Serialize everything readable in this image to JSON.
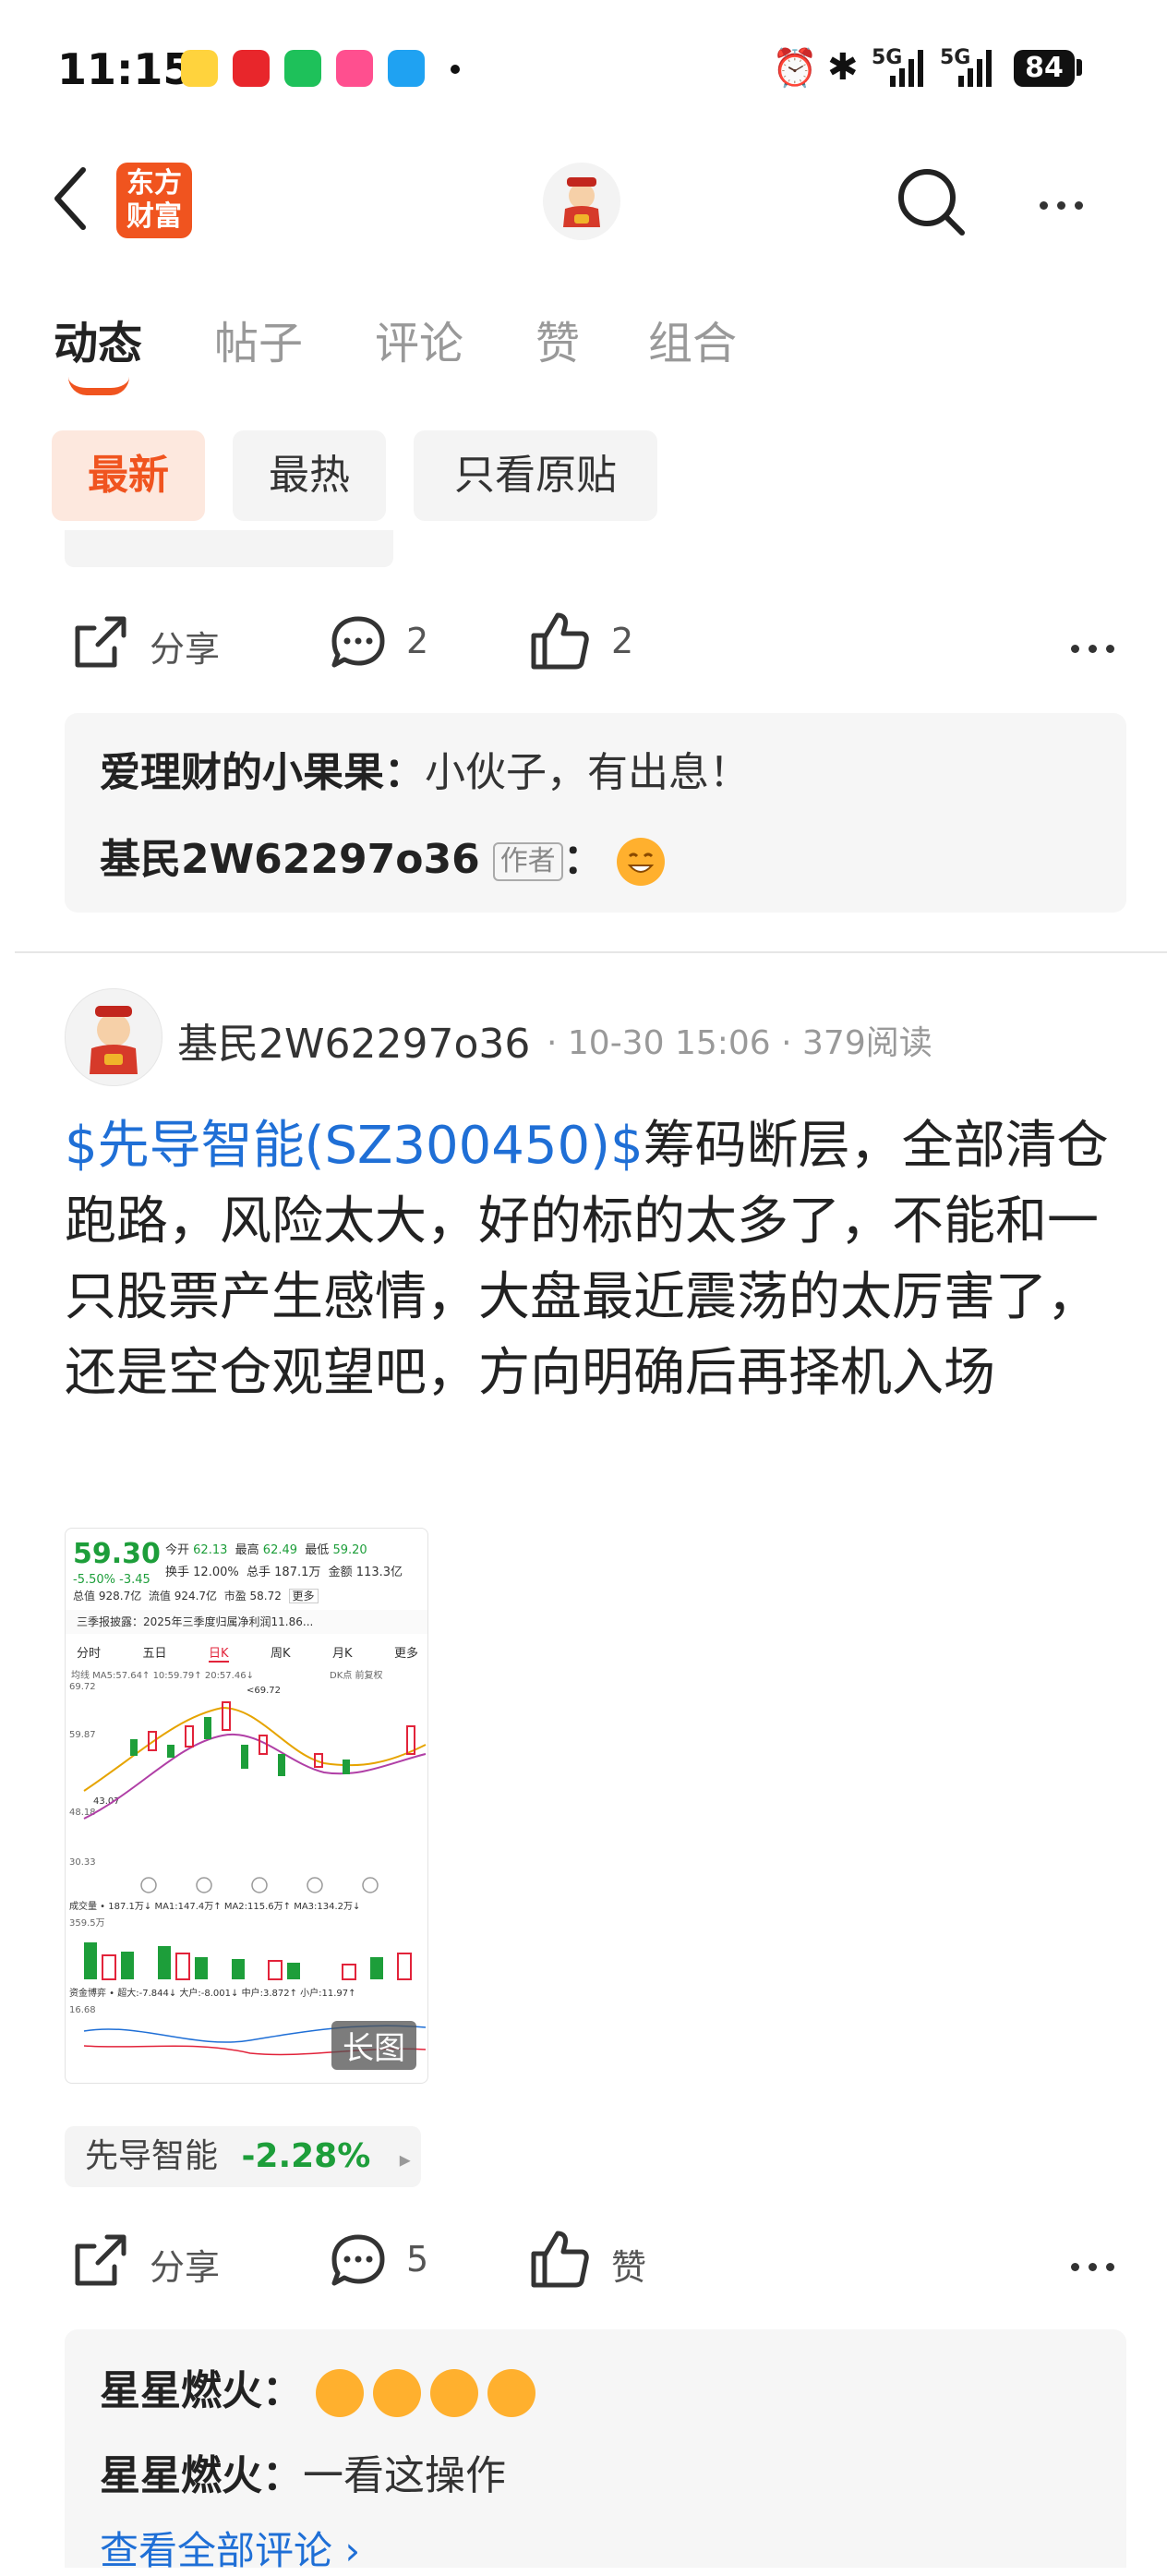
{
  "status_bar": {
    "time": "11:15",
    "network1": "5G",
    "network2": "5G",
    "battery": "84"
  },
  "header": {
    "logo_text_line1": "东方",
    "logo_text_line2": "财富"
  },
  "tabs": [
    {
      "label": "动态",
      "active": true
    },
    {
      "label": "帖子"
    },
    {
      "label": "评论"
    },
    {
      "label": "赞"
    },
    {
      "label": "组合"
    }
  ],
  "filters": [
    {
      "label": "最新",
      "active": true
    },
    {
      "label": "最热"
    },
    {
      "label": "只看原贴"
    }
  ],
  "post1": {
    "share_label": "分享",
    "comment_count": "2",
    "like_count": "2",
    "comments": [
      {
        "name": "爱理财的小果果",
        "sep": "：",
        "text": "小伙子，有出息！"
      },
      {
        "name": "基民2W62297o36",
        "badge": "作者",
        "sep": "："
      }
    ]
  },
  "post2": {
    "author": "基民2W62297o36",
    "meta": "· 10-30 15:06 · 379阅读",
    "stock_link": "$先导智能(SZ300450)$",
    "body": "筹码断层，全部清仓跑路，风险太大，好的标的太多了，不能和一只股票产生感情，大盘最近震荡的太厉害了，还是空仓观望吧，方向明确后再择机入场",
    "image_badge": "长图",
    "quote": {
      "price": "59.30",
      "change": "-5.50%",
      "change_abs": "-3.45",
      "open_label": "今开",
      "open": "62.13",
      "high_label": "最高",
      "high": "62.49",
      "low_label": "最低",
      "low": "59.20",
      "turnover_label": "换手",
      "turnover": "12.00%",
      "vol_label": "总手",
      "vol": "187.1万",
      "amount_label": "金额",
      "amount": "113.3亿",
      "mcap_label": "总值",
      "mcap": "928.7亿",
      "float_label": "流值",
      "float": "924.7亿",
      "pe_label": "市盈",
      "pe": "58.72",
      "more_label": "更多",
      "notice": "三季报披露：2025年三季度归属净利润11.86...",
      "periods": [
        "分时",
        "五日",
        "日K",
        "周K",
        "月K",
        "更多"
      ],
      "ma_line": "均线 MA5:57.64↑ 10:59.79↑ 20:57.46↓",
      "dk": "DK点",
      "fq": "前复权",
      "price_marks": [
        "69.72",
        "59.87",
        "48.18",
        "43.07",
        "30.33",
        "<69.72"
      ],
      "vol_line": "成交量 • 187.1万↓ MA1:147.4万↑ MA2:115.6万↑ MA3:134.2万↓",
      "vol_mark": "359.5万",
      "fund_line": "资金博弈 • 超大:-7.844↓ 大户:-8.001↓ 中户:3.872↑ 小户:11.97↑",
      "fund_mark": "16.68"
    },
    "stock_tag": {
      "name": "先导智能",
      "change": "-2.28%"
    },
    "share_label": "分享",
    "comment_count": "5",
    "like_label": "赞",
    "comments": [
      {
        "name": "星星燃火",
        "sep": "："
      },
      {
        "name": "星星燃火",
        "sep": "：",
        "text": "一看这操作"
      }
    ],
    "view_all": "查看全部评论 ›"
  },
  "colors": {
    "accent": "#f0541f",
    "link": "#1f6fd6",
    "down": "#1d9e3a",
    "up": "#e2233a"
  }
}
